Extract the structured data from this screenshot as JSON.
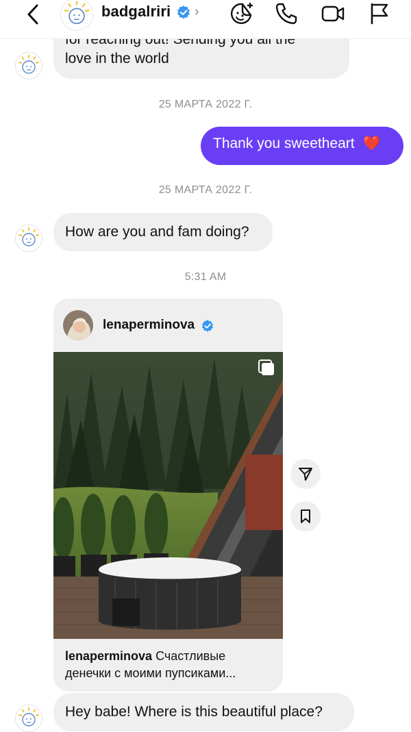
{
  "header": {
    "back_icon": "chevron-left-icon",
    "username": "badgalriri",
    "verified": true,
    "actions": [
      "sticker-icon",
      "phone-icon",
      "video-icon",
      "flag-icon"
    ]
  },
  "messages": [
    {
      "type": "in",
      "text_line1": "for reaching out! Sending you all the",
      "text_line2": "love in the world"
    },
    {
      "type": "date",
      "text": "25 МАРТА 2022 Г."
    },
    {
      "type": "out",
      "text": "Thank you sweetheart",
      "emoji": "❤️"
    },
    {
      "type": "date",
      "text": "25 МАРТА 2022 Г."
    },
    {
      "type": "in",
      "text": "How are you and fam doing?"
    },
    {
      "type": "time",
      "text": "5:31 AM"
    },
    {
      "type": "post",
      "author": "lenaperminova",
      "caption_author": "lenaperminova",
      "caption_line1": "Счастливые",
      "caption_line2": "денечки с моими пупсиками..."
    },
    {
      "type": "in",
      "text": "Hey babe! Where is this beautiful place?"
    }
  ],
  "colors": {
    "accent": "#6a3ef5",
    "incoming_bubble": "#efefef",
    "verified_blue": "#3897f0",
    "timestamp": "#8e8e8e"
  }
}
